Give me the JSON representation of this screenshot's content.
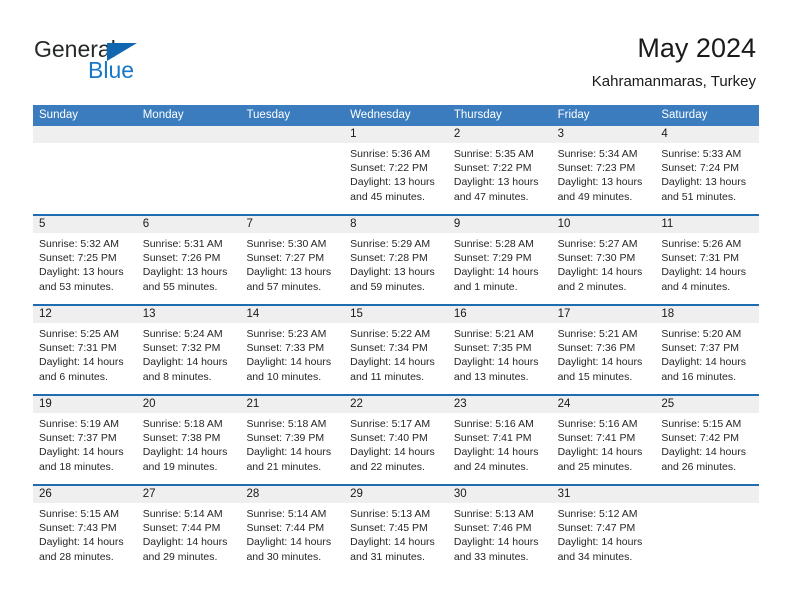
{
  "brand": {
    "name_part1": "General",
    "name_part2": "Blue"
  },
  "header": {
    "title": "May 2024",
    "subtitle": "Kahramanmaras, Turkey"
  },
  "colors": {
    "header_blue": "#3a7cbe",
    "row_divider_blue": "#1f6cb0",
    "day_band_gray": "#efefef",
    "logo_blue": "#1878c8",
    "text": "#262626"
  },
  "weekdays": [
    "Sunday",
    "Monday",
    "Tuesday",
    "Wednesday",
    "Thursday",
    "Friday",
    "Saturday"
  ],
  "weeks": [
    [
      {
        "day": "",
        "lines": []
      },
      {
        "day": "",
        "lines": []
      },
      {
        "day": "",
        "lines": []
      },
      {
        "day": "1",
        "lines": [
          "Sunrise: 5:36 AM",
          "Sunset: 7:22 PM",
          "Daylight: 13 hours",
          "and 45 minutes."
        ]
      },
      {
        "day": "2",
        "lines": [
          "Sunrise: 5:35 AM",
          "Sunset: 7:22 PM",
          "Daylight: 13 hours",
          "and 47 minutes."
        ]
      },
      {
        "day": "3",
        "lines": [
          "Sunrise: 5:34 AM",
          "Sunset: 7:23 PM",
          "Daylight: 13 hours",
          "and 49 minutes."
        ]
      },
      {
        "day": "4",
        "lines": [
          "Sunrise: 5:33 AM",
          "Sunset: 7:24 PM",
          "Daylight: 13 hours",
          "and 51 minutes."
        ]
      }
    ],
    [
      {
        "day": "5",
        "lines": [
          "Sunrise: 5:32 AM",
          "Sunset: 7:25 PM",
          "Daylight: 13 hours",
          "and 53 minutes."
        ]
      },
      {
        "day": "6",
        "lines": [
          "Sunrise: 5:31 AM",
          "Sunset: 7:26 PM",
          "Daylight: 13 hours",
          "and 55 minutes."
        ]
      },
      {
        "day": "7",
        "lines": [
          "Sunrise: 5:30 AM",
          "Sunset: 7:27 PM",
          "Daylight: 13 hours",
          "and 57 minutes."
        ]
      },
      {
        "day": "8",
        "lines": [
          "Sunrise: 5:29 AM",
          "Sunset: 7:28 PM",
          "Daylight: 13 hours",
          "and 59 minutes."
        ]
      },
      {
        "day": "9",
        "lines": [
          "Sunrise: 5:28 AM",
          "Sunset: 7:29 PM",
          "Daylight: 14 hours",
          "and 1 minute."
        ]
      },
      {
        "day": "10",
        "lines": [
          "Sunrise: 5:27 AM",
          "Sunset: 7:30 PM",
          "Daylight: 14 hours",
          "and 2 minutes."
        ]
      },
      {
        "day": "11",
        "lines": [
          "Sunrise: 5:26 AM",
          "Sunset: 7:31 PM",
          "Daylight: 14 hours",
          "and 4 minutes."
        ]
      }
    ],
    [
      {
        "day": "12",
        "lines": [
          "Sunrise: 5:25 AM",
          "Sunset: 7:31 PM",
          "Daylight: 14 hours",
          "and 6 minutes."
        ]
      },
      {
        "day": "13",
        "lines": [
          "Sunrise: 5:24 AM",
          "Sunset: 7:32 PM",
          "Daylight: 14 hours",
          "and 8 minutes."
        ]
      },
      {
        "day": "14",
        "lines": [
          "Sunrise: 5:23 AM",
          "Sunset: 7:33 PM",
          "Daylight: 14 hours",
          "and 10 minutes."
        ]
      },
      {
        "day": "15",
        "lines": [
          "Sunrise: 5:22 AM",
          "Sunset: 7:34 PM",
          "Daylight: 14 hours",
          "and 11 minutes."
        ]
      },
      {
        "day": "16",
        "lines": [
          "Sunrise: 5:21 AM",
          "Sunset: 7:35 PM",
          "Daylight: 14 hours",
          "and 13 minutes."
        ]
      },
      {
        "day": "17",
        "lines": [
          "Sunrise: 5:21 AM",
          "Sunset: 7:36 PM",
          "Daylight: 14 hours",
          "and 15 minutes."
        ]
      },
      {
        "day": "18",
        "lines": [
          "Sunrise: 5:20 AM",
          "Sunset: 7:37 PM",
          "Daylight: 14 hours",
          "and 16 minutes."
        ]
      }
    ],
    [
      {
        "day": "19",
        "lines": [
          "Sunrise: 5:19 AM",
          "Sunset: 7:37 PM",
          "Daylight: 14 hours",
          "and 18 minutes."
        ]
      },
      {
        "day": "20",
        "lines": [
          "Sunrise: 5:18 AM",
          "Sunset: 7:38 PM",
          "Daylight: 14 hours",
          "and 19 minutes."
        ]
      },
      {
        "day": "21",
        "lines": [
          "Sunrise: 5:18 AM",
          "Sunset: 7:39 PM",
          "Daylight: 14 hours",
          "and 21 minutes."
        ]
      },
      {
        "day": "22",
        "lines": [
          "Sunrise: 5:17 AM",
          "Sunset: 7:40 PM",
          "Daylight: 14 hours",
          "and 22 minutes."
        ]
      },
      {
        "day": "23",
        "lines": [
          "Sunrise: 5:16 AM",
          "Sunset: 7:41 PM",
          "Daylight: 14 hours",
          "and 24 minutes."
        ]
      },
      {
        "day": "24",
        "lines": [
          "Sunrise: 5:16 AM",
          "Sunset: 7:41 PM",
          "Daylight: 14 hours",
          "and 25 minutes."
        ]
      },
      {
        "day": "25",
        "lines": [
          "Sunrise: 5:15 AM",
          "Sunset: 7:42 PM",
          "Daylight: 14 hours",
          "and 26 minutes."
        ]
      }
    ],
    [
      {
        "day": "26",
        "lines": [
          "Sunrise: 5:15 AM",
          "Sunset: 7:43 PM",
          "Daylight: 14 hours",
          "and 28 minutes."
        ]
      },
      {
        "day": "27",
        "lines": [
          "Sunrise: 5:14 AM",
          "Sunset: 7:44 PM",
          "Daylight: 14 hours",
          "and 29 minutes."
        ]
      },
      {
        "day": "28",
        "lines": [
          "Sunrise: 5:14 AM",
          "Sunset: 7:44 PM",
          "Daylight: 14 hours",
          "and 30 minutes."
        ]
      },
      {
        "day": "29",
        "lines": [
          "Sunrise: 5:13 AM",
          "Sunset: 7:45 PM",
          "Daylight: 14 hours",
          "and 31 minutes."
        ]
      },
      {
        "day": "30",
        "lines": [
          "Sunrise: 5:13 AM",
          "Sunset: 7:46 PM",
          "Daylight: 14 hours",
          "and 33 minutes."
        ]
      },
      {
        "day": "31",
        "lines": [
          "Sunrise: 5:12 AM",
          "Sunset: 7:47 PM",
          "Daylight: 14 hours",
          "and 34 minutes."
        ]
      },
      {
        "day": "",
        "lines": []
      }
    ]
  ]
}
